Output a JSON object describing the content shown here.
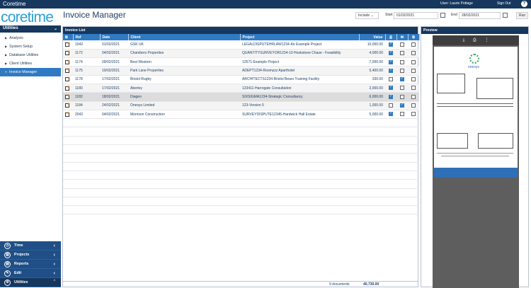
{
  "topbar": {
    "brand": "Coretime",
    "user": "User: Laurie Pottage",
    "signout": "Sign Out",
    "help": "?"
  },
  "sidebar": {
    "logo": "coretime",
    "section": "Utilities",
    "items": [
      {
        "label": "Analysis"
      },
      {
        "label": "System Setup"
      },
      {
        "label": "Database Utilities"
      },
      {
        "label": "Client Utilities"
      },
      {
        "label": "Invoice Manager"
      }
    ],
    "bottom": [
      {
        "label": "Time"
      },
      {
        "label": "Projects"
      },
      {
        "label": "Reports"
      },
      {
        "label": "Edit"
      },
      {
        "label": "Utilities"
      }
    ]
  },
  "header": {
    "title": "Invoice Manager",
    "include_label": "Include",
    "start_label": "Start",
    "start_value": "01/02/2021",
    "end_label": "End",
    "end_value": "28/02/2021",
    "run_label": "Run"
  },
  "invoice_list": {
    "title": "Invoice List",
    "columns": [
      "Ref",
      "Date",
      "Client",
      "Project",
      "Value"
    ],
    "rows": [
      {
        "ref": "1042",
        "date": "01/02/2021",
        "client": "GSK UK",
        "project": "LEGALDISPUTEHRLAW1234-An Example Project",
        "value": "10,000.00",
        "c1": true,
        "c2": false,
        "c3": false
      },
      {
        "ref": "1172",
        "date": "04/02/2021",
        "client": "Chambers Properties",
        "project": "QUANTITYSURVEYOR1234-10 Hookstone Chase - Feasibility",
        "value": "4,000.00",
        "c1": true,
        "c2": false,
        "c3": false
      },
      {
        "ref": "1174",
        "date": "09/02/2021",
        "client": "Best Western",
        "project": "12571-Example Project",
        "value": "7,000.00",
        "c1": true,
        "c2": false,
        "c3": false
      },
      {
        "ref": "1175",
        "date": "10/02/2021",
        "client": "Park Lane Properties",
        "project": "ADEPT1234-Roomzzz Aparthotel",
        "value": "5,400.00",
        "c1": true,
        "c2": false,
        "c3": false
      },
      {
        "ref": "1178",
        "date": "17/02/2021",
        "client": "Bristol Rugby",
        "project": "ARCHITECTS1234-Bristol Bears Training Facility",
        "value": "330.00",
        "c1": false,
        "c2": true,
        "c3": false
      },
      {
        "ref": "1180",
        "date": "17/02/2021",
        "client": "Aberley",
        "project": "123411-Harrogate Consultation",
        "value": "2,000.00",
        "c1": true,
        "c2": false,
        "c3": false
      },
      {
        "ref": "1182",
        "date": "18/02/2021",
        "client": "Diageo",
        "project": "SIXSIGMA1234-Strategic Consultancy",
        "value": "6,000.00",
        "c1": true,
        "c2": false,
        "c3": false
      },
      {
        "ref": "1184",
        "date": "24/02/2021",
        "client": "Onesys Limited",
        "project": "123-Version 5",
        "value": "1,000.00",
        "c1": false,
        "c2": true,
        "c3": false
      },
      {
        "ref": "2042",
        "date": "04/02/2021",
        "client": "Morrison Construction",
        "project": "SURVEYDISPUTE12345-Hardwick Hall Estate",
        "value": "5,000.00",
        "c1": true,
        "c2": false,
        "c3": false
      }
    ],
    "total_docs": "9 documents",
    "total_value": "40,730.00"
  },
  "preview": {
    "title": "Preview",
    "logo_text": "onesys"
  },
  "colors": {
    "navy": "#16375e",
    "accent": "#2f7ac3",
    "logo": "#2aa1d6"
  },
  "icons": [
    "download-icon",
    "print-icon",
    "more-icon",
    "calendar-icon",
    "help-icon"
  ]
}
